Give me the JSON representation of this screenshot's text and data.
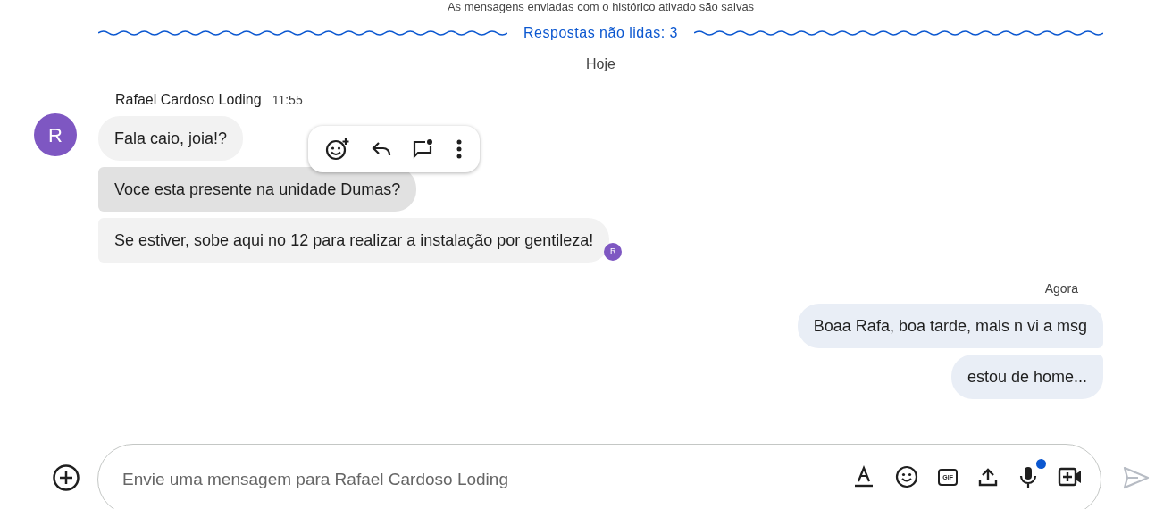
{
  "history_notice": "As mensagens enviadas com o histórico ativado são salvas",
  "unread_divider": "Respostas não lidas: 3",
  "date_divider": "Hoje",
  "incoming": {
    "avatar": "R",
    "sender": "Rafael Cardoso Loding",
    "time": "11:55",
    "messages": [
      {
        "text": "Fala caio, joia!?",
        "selected": false
      },
      {
        "text": "Voce esta presente na unidade Dumas?",
        "selected": true
      },
      {
        "text": "Se estiver, sobe aqui no 12 para realizar a instalação por gentileza!",
        "selected": false
      }
    ],
    "read_receipt": "R"
  },
  "outgoing": {
    "time": "Agora",
    "messages": [
      {
        "text": "Boaa Rafa, boa tarde, mals n vi a msg"
      },
      {
        "text": "estou de home..."
      }
    ]
  },
  "composer": {
    "placeholder": "Envie uma mensagem para Rafael Cardoso Loding",
    "gif_label": "GIF",
    "mic_indicator": true
  }
}
